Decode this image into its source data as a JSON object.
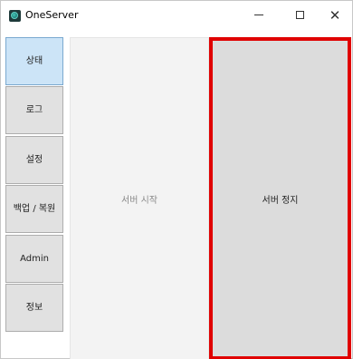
{
  "window": {
    "title": "OneServer",
    "controls": {
      "minimize": "minimize-icon",
      "maximize": "maximize-icon",
      "close": "close-icon"
    }
  },
  "sidebar": {
    "items": [
      {
        "label": "상태",
        "active": true
      },
      {
        "label": "로그",
        "active": false
      },
      {
        "label": "설정",
        "active": false
      },
      {
        "label": "백업 / 복원",
        "active": false
      },
      {
        "label": "Admin",
        "active": false
      },
      {
        "label": "정보",
        "active": false
      }
    ]
  },
  "main": {
    "start_label": "서버 시작",
    "stop_label": "서버 정지"
  },
  "colors": {
    "active_nav": "#cce4f7",
    "highlight_border": "#e00000",
    "button_bg": "#e1e1e1"
  }
}
